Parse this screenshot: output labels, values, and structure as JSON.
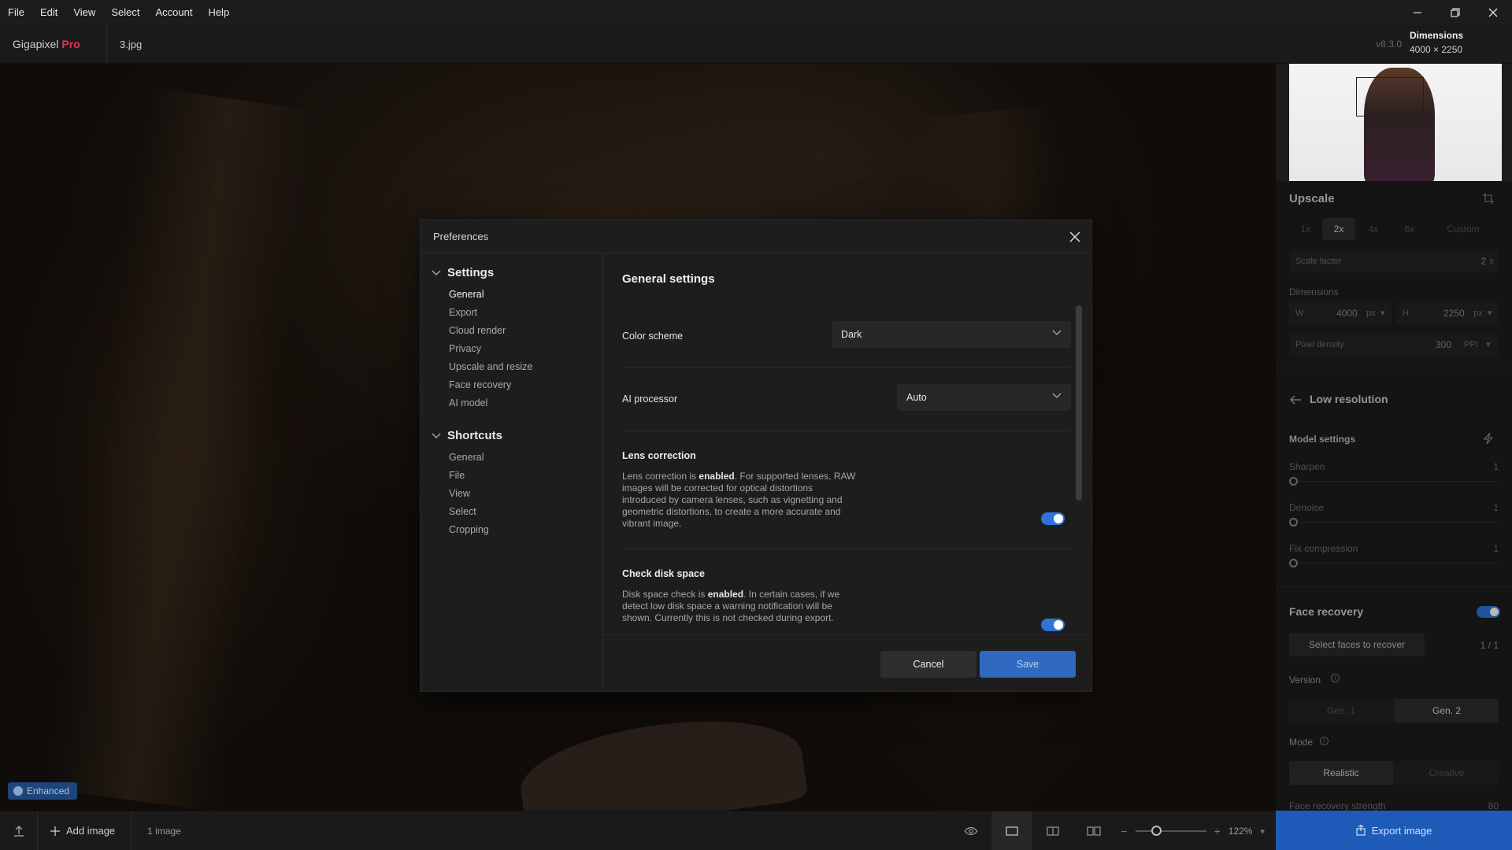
{
  "menubar": {
    "items": [
      "File",
      "Edit",
      "View",
      "Select",
      "Account",
      "Help"
    ]
  },
  "titlebar": {
    "app_name": "Gigapixel",
    "app_tier": "Pro",
    "file_name": "3.jpg",
    "version": "v8.3.0",
    "dimensions_label": "Dimensions",
    "dimensions_value": "4000 × 2250"
  },
  "canvas": {
    "badge": "Enhanced"
  },
  "right_panel": {
    "upscale_title": "Upscale",
    "scale_options": [
      "1x",
      "2x",
      "4x",
      "6x",
      "Custom"
    ],
    "selected_scale": "2x",
    "scale_factor_label": "Scale factor",
    "scale_factor_value": "2",
    "scale_factor_unit": "x",
    "dimensions_label": "Dimensions",
    "width_label": "W",
    "width_value": "4000",
    "width_unit": "px",
    "height_label": "H",
    "height_value": "2250",
    "height_unit": "px",
    "pixel_density_label": "Pixel density",
    "pixel_density_value": "300",
    "pixel_density_unit": "PPI",
    "model_name": "Low resolution",
    "model_settings_label": "Model settings",
    "sliders": [
      {
        "label": "Sharpen",
        "value": "1"
      },
      {
        "label": "Denoise",
        "value": "1"
      },
      {
        "label": "Fix compression",
        "value": "1"
      }
    ],
    "face_recovery_label": "Face recovery",
    "face_recovery_enabled": true,
    "select_faces_label": "Select faces to recover",
    "faces_count": "1 / 1",
    "version_label": "Version",
    "version_options": [
      "Gen. 1",
      "Gen. 2"
    ],
    "selected_version": "Gen. 2",
    "mode_label": "Mode",
    "mode_options": [
      "Realistic",
      "Creative"
    ],
    "selected_mode": "Realistic",
    "face_strength_label": "Face recovery strength",
    "face_strength_value": "80"
  },
  "bottombar": {
    "add_image_label": "Add image",
    "image_count": "1 image",
    "zoom_value": "122%",
    "export_label": "Export image"
  },
  "modal": {
    "title": "Preferences",
    "nav_groups": [
      {
        "label": "Settings",
        "items": [
          "General",
          "Export",
          "Cloud render",
          "Privacy",
          "Upscale and resize",
          "Face recovery",
          "AI model"
        ]
      },
      {
        "label": "Shortcuts",
        "items": [
          "General",
          "File",
          "View",
          "Select",
          "Cropping"
        ]
      }
    ],
    "active_item": "General",
    "content_title": "General settings",
    "color_scheme_label": "Color scheme",
    "color_scheme_value": "Dark",
    "ai_processor_label": "AI processor",
    "ai_processor_value": "Auto",
    "lens_correction_title": "Lens correction",
    "lens_correction_desc_pre": "Lens correction is ",
    "lens_correction_desc_bold": "enabled",
    "lens_correction_desc_post": ". For supported lenses, RAW images will be corrected for optical distortions introduced by camera lenses, such as vignetting and geometric distortions, to create a more accurate and vibrant image.",
    "lens_correction_enabled": true,
    "disk_space_title": "Check disk space",
    "disk_space_desc_pre": "Disk space check is ",
    "disk_space_desc_bold": "enabled",
    "disk_space_desc_post": ". In certain cases, if we detect low disk space a warning notification will be shown. Currently this is not checked during export.",
    "disk_space_enabled": true,
    "cancel_label": "Cancel",
    "save_label": "Save"
  }
}
